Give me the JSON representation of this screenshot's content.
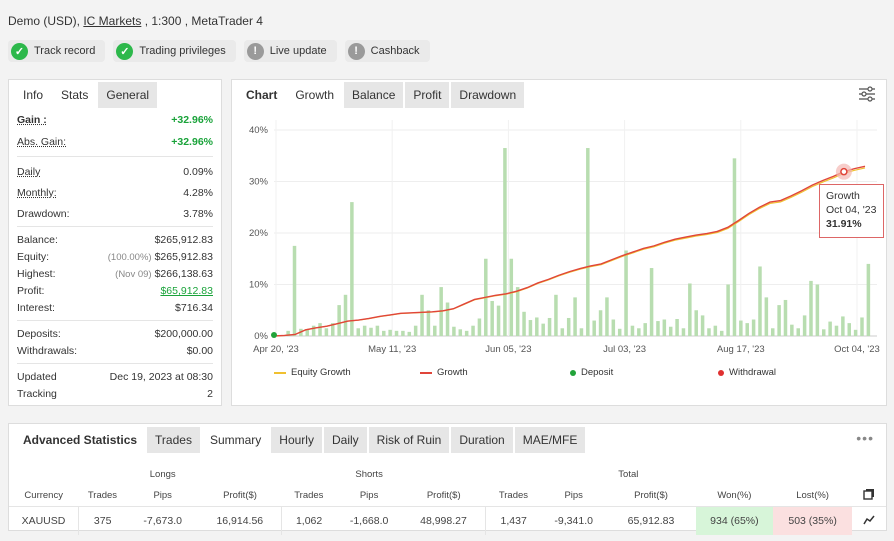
{
  "header": {
    "prefix": "Demo (USD), ",
    "broker": "IC Markets",
    "suffix": " , 1:300 , MetaTrader 4",
    "badges": [
      {
        "label": "Track record",
        "icon": "check-icon",
        "state": "ok"
      },
      {
        "label": "Trading privileges",
        "icon": "check-icon",
        "state": "ok"
      },
      {
        "label": "Live update",
        "icon": "exclamation-icon",
        "state": "warn"
      },
      {
        "label": "Cashback",
        "icon": "exclamation-icon",
        "state": "warn"
      }
    ]
  },
  "left": {
    "tabs": [
      "Info",
      "Stats",
      "General"
    ],
    "gain_label": "Gain :",
    "gain_value": "+32.96%",
    "absgain_label": "Abs. Gain:",
    "absgain_value": "+32.96%",
    "daily_label": "Daily",
    "daily_value": "0.09%",
    "monthly_label": "Monthly:",
    "monthly_value": "4.28%",
    "drawdown_label": "Drawdown:",
    "drawdown_value": "3.78%",
    "balance_label": "Balance:",
    "balance_value": "$265,912.83",
    "equity_label": "Equity:",
    "equity_sub": "(100.00%)",
    "equity_value": "$265,912.83",
    "highest_label": "Highest:",
    "highest_sub": "(Nov 09)",
    "highest_value": "$266,138.63",
    "profit_label": "Profit:",
    "profit_value": "$65,912.83",
    "interest_label": "Interest:",
    "interest_value": "$716.34",
    "deposits_label": "Deposits:",
    "deposits_value": "$200,000.00",
    "withdrawals_label": "Withdrawals:",
    "withdrawals_value": "$0.00",
    "updated_label": "Updated",
    "updated_value": "Dec 19, 2023 at 08:30",
    "tracking_label": "Tracking",
    "tracking_value": "2"
  },
  "chart": {
    "tabs": [
      "Chart",
      "Growth",
      "Balance",
      "Profit",
      "Drawdown"
    ],
    "tooltip": {
      "title": "Growth",
      "date": "Oct 04, '23",
      "value": "31.91%"
    },
    "legend": [
      "Equity Growth",
      "Growth",
      "Deposit",
      "Withdrawal"
    ]
  },
  "chart_data": {
    "type": "line",
    "ylim": [
      0,
      40
    ],
    "y_ticks": [
      "40%",
      "30%",
      "20%",
      "10%",
      "0%"
    ],
    "x_ticks": [
      "Apr 20, '23",
      "May 11, '23",
      "Jun 05, '23",
      "Jul 03, '23",
      "Aug 17, '23",
      "Oct 04, '23"
    ],
    "growth": [
      0,
      0.1,
      0.3,
      1.2,
      1.6,
      1.9,
      2.4,
      2.9,
      3.1,
      3.4,
      3.8,
      4.1,
      4.4,
      4.5,
      4.6,
      4.7,
      4.9,
      5.3,
      6.2,
      7.1,
      7.5,
      7.9,
      8.2,
      8.7,
      9.4,
      10.3,
      11.0,
      11.8,
      12.5,
      13.1,
      13.6,
      14.0,
      14.8,
      15.6,
      16.3,
      17.0,
      17.5,
      18.2,
      18.8,
      19.2,
      19.6,
      19.9,
      20.3,
      21.1,
      22.4,
      23.8,
      25.0,
      26.0,
      26.3,
      27.2,
      28.2,
      29.3,
      30.2,
      31.0,
      31.91,
      32.5,
      32.96
    ],
    "bars": [
      0,
      1,
      17.5,
      1.4,
      1.2,
      2,
      2.5,
      1.5,
      2.5,
      6,
      8,
      26,
      1.5,
      2,
      1.6,
      2,
      1,
      1.2,
      1,
      1,
      0.8,
      2,
      8,
      5,
      2,
      9.5,
      6.5,
      1.8,
      1.3,
      1,
      2,
      3.4,
      15,
      6.8,
      5.9,
      36.5,
      15,
      9.5,
      4.7,
      3.1,
      3.6,
      2.4,
      3.5,
      8,
      1.5,
      3.5,
      7.5,
      1.5,
      36.5,
      3,
      5,
      7.5,
      3.2,
      1.4,
      16.6,
      2,
      1.5,
      2.5,
      13.2,
      2.9,
      3.2,
      1.8,
      3.3,
      1.5,
      10.2,
      5,
      4,
      1.5,
      2,
      1,
      10,
      34.5,
      3,
      2.5,
      3.2,
      13.5,
      7.5,
      1.5,
      6,
      7,
      2.2,
      1.5,
      4,
      10.7,
      10,
      1.3,
      2.8,
      2,
      3.8,
      2.5,
      1.2,
      3.6,
      14
    ]
  },
  "advanced": {
    "title": "Advanced Statistics",
    "tabs": [
      "Trades",
      "Summary",
      "Hourly",
      "Daily",
      "Risk of Ruin",
      "Duration",
      "MAE/MFE"
    ],
    "groups": [
      "Longs",
      "Shorts",
      "Total"
    ],
    "headers": [
      "Currency",
      "Trades",
      "Pips",
      "Profit($)",
      "Trades",
      "Pips",
      "Profit($)",
      "Trades",
      "Pips",
      "Profit($)",
      "Won(%)",
      "Lost(%)"
    ],
    "row": [
      "XAUUSD",
      "375",
      "-7,673.0",
      "16,914.56",
      "1,062",
      "-1,668.0",
      "48,998.27",
      "1,437",
      "-9,341.0",
      "65,912.83",
      "934 (65%)",
      "503 (35%)"
    ]
  }
}
